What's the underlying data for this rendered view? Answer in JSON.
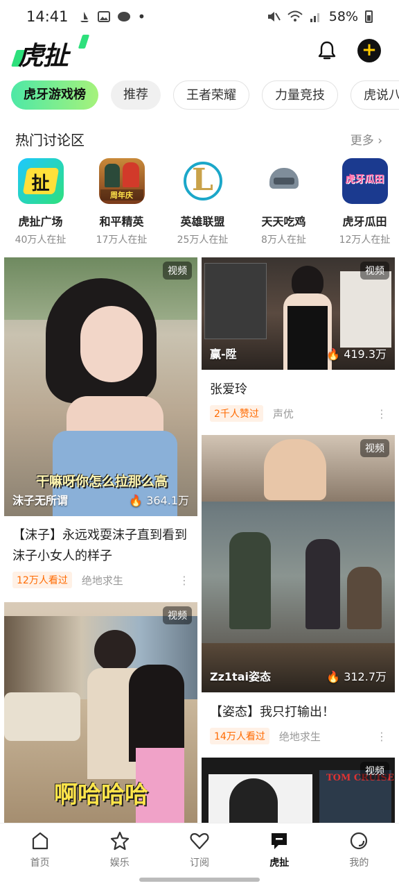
{
  "status_bar": {
    "time": "14:41",
    "battery": "58%"
  },
  "header": {
    "logo_text": "虎扯",
    "accent": "#2ee07c"
  },
  "tabs": [
    {
      "label": "虎牙游戏榜",
      "active": true
    },
    {
      "label": "推荐"
    },
    {
      "label": "王者荣耀"
    },
    {
      "label": "力量竞技"
    },
    {
      "label": "虎说八卦"
    }
  ],
  "hot_section": {
    "title": "热门讨论区",
    "more": "更多 ›",
    "items": [
      {
        "name": "虎扯广场",
        "online": "40万人在扯",
        "icon": "huche-square-icon",
        "icon_text": "扯"
      },
      {
        "name": "和平精英",
        "online": "17万人在扯",
        "icon": "peace-elite-icon",
        "icon_text": "周年庆"
      },
      {
        "name": "英雄联盟",
        "online": "25万人在扯",
        "icon": "lol-icon",
        "icon_text": "L"
      },
      {
        "name": "天天吃鸡",
        "online": "8万人在扯",
        "icon": "helmet-icon"
      },
      {
        "name": "虎牙瓜田",
        "online": "12万人在扯",
        "icon": "huya-melon-icon",
        "icon_text": "虎牙瓜田"
      }
    ]
  },
  "feed": {
    "left": [
      {
        "badge": "视频",
        "author": "沫子无所谓",
        "hot": "364.1万",
        "overlay": "干嘛呀你怎么拉那么高",
        "caption": "【沫子】永远戏耍沫子直到看到沫子小女人的样子",
        "tag": "12万人看过",
        "category": "绝地求生"
      },
      {
        "badge": "视频",
        "overlay": "啊哈哈哈"
      }
    ],
    "right": [
      {
        "badge": "视频",
        "author": "赢-陞",
        "hot": "419.3万",
        "caption": "张爱玲",
        "tag": "2千人赞过",
        "category": "声优"
      },
      {
        "badge": "视频",
        "author": "Zz1tai姿态",
        "hot": "312.7万",
        "caption": "【姿态】我只打输出！",
        "tag": "14万人看过",
        "category": "绝地求生"
      },
      {
        "badge": "视频",
        "poster_text": "TOM CRUISE"
      }
    ]
  },
  "bottom_nav": [
    {
      "label": "首页",
      "icon": "home-icon"
    },
    {
      "label": "娱乐",
      "icon": "star-icon"
    },
    {
      "label": "订阅",
      "icon": "heart-icon"
    },
    {
      "label": "虎扯",
      "icon": "chat-icon",
      "active": true
    },
    {
      "label": "我的",
      "icon": "profile-icon"
    }
  ]
}
